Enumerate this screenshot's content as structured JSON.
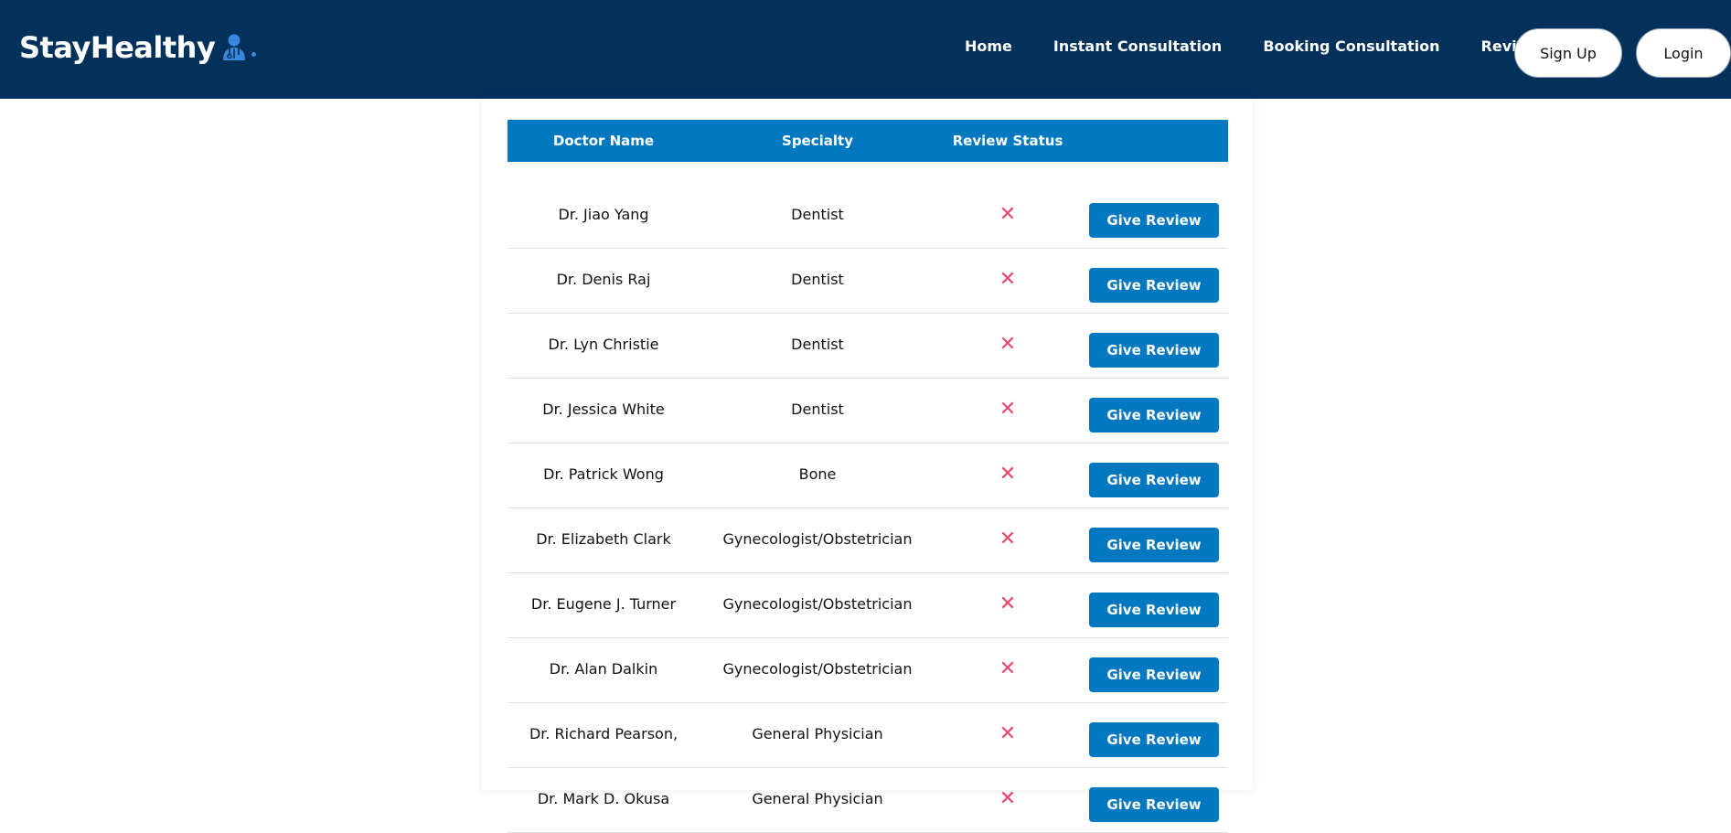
{
  "brand": {
    "name": "StayHealthy",
    "icon": "doctor-icon",
    "accent_color": "#3b87e0"
  },
  "nav": {
    "links": [
      "Home",
      "Instant Consultation",
      "Booking Consultation",
      "Reviews"
    ],
    "sign_up": "Sign Up",
    "login": "Login",
    "background": "#02315c"
  },
  "table": {
    "headers": {
      "doctor_name": "Doctor Name",
      "specialty": "Specialty",
      "review_status": "Review Status",
      "action": ""
    },
    "header_color": "#0178bf",
    "status_icon": "cross-icon",
    "status_color": "#e8486b",
    "rows": [
      {
        "name": "Dr. Jiao Yang",
        "specialty": "Dentist",
        "status": "✕",
        "action": "Give Review"
      },
      {
        "name": "Dr. Denis Raj",
        "specialty": "Dentist",
        "status": "✕",
        "action": "Give Review"
      },
      {
        "name": "Dr. Lyn Christie",
        "specialty": "Dentist",
        "status": "✕",
        "action": "Give Review"
      },
      {
        "name": "Dr. Jessica White",
        "specialty": "Dentist",
        "status": "✕",
        "action": "Give Review"
      },
      {
        "name": "Dr. Patrick Wong",
        "specialty": "Bone",
        "status": "✕",
        "action": "Give Review"
      },
      {
        "name": "Dr. Elizabeth Clark",
        "specialty": "Gynecologist/Obstetrician",
        "status": "✕",
        "action": "Give Review"
      },
      {
        "name": "Dr. Eugene J. Turner",
        "specialty": "Gynecologist/Obstetrician",
        "status": "✕",
        "action": "Give Review"
      },
      {
        "name": "Dr. Alan Dalkin",
        "specialty": "Gynecologist/Obstetrician",
        "status": "✕",
        "action": "Give Review"
      },
      {
        "name": "Dr. Richard Pearson,",
        "specialty": "General Physician",
        "status": "✕",
        "action": "Give Review"
      },
      {
        "name": "Dr. Mark D. Okusa",
        "specialty": "General Physician",
        "status": "✕",
        "action": "Give Review"
      }
    ]
  }
}
